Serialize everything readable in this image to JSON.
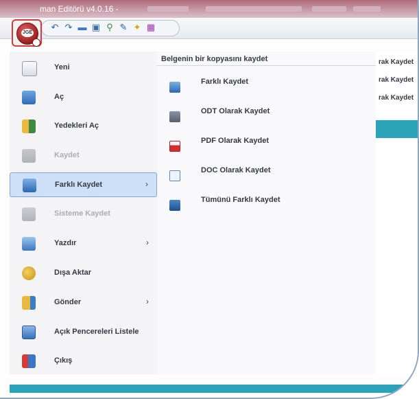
{
  "window": {
    "title": "man Editörü v4.0.16 -"
  },
  "toolbar": {
    "icons": [
      "undo-icon",
      "redo-icon",
      "folder-icon",
      "save-icon",
      "plug-icon",
      "edit-icon",
      "star-icon",
      "grid-icon"
    ],
    "logo_text": "JGE"
  },
  "menu": {
    "items": [
      {
        "label": "Yeni",
        "icon": "new-document-icon",
        "enabled": true,
        "submenu": false
      },
      {
        "label": "Aç",
        "icon": "open-folder-icon",
        "enabled": true,
        "submenu": false
      },
      {
        "label": "Yedekleri Aç",
        "icon": "backup-icon",
        "enabled": true,
        "submenu": false
      },
      {
        "label": "Kaydet",
        "icon": "save-icon",
        "enabled": false,
        "submenu": false
      },
      {
        "label": "Farklı Kaydet",
        "icon": "save-as-icon",
        "enabled": true,
        "submenu": true,
        "active": true
      },
      {
        "label": "Sisteme Kaydet",
        "icon": "system-save-icon",
        "enabled": false,
        "submenu": false
      },
      {
        "label": "Yazdır",
        "icon": "printer-icon",
        "enabled": true,
        "submenu": true
      },
      {
        "label": "Dışa Aktar",
        "icon": "export-icon",
        "enabled": true,
        "submenu": false
      },
      {
        "label": "Gönder",
        "icon": "send-icon",
        "enabled": true,
        "submenu": true
      },
      {
        "label": "Açık Pencereleri Listele",
        "icon": "windows-list-icon",
        "enabled": true,
        "submenu": false
      },
      {
        "label": "Çıkış",
        "icon": "exit-icon",
        "enabled": true,
        "submenu": false
      }
    ],
    "arrow": "›"
  },
  "submenu": {
    "header": "Belgenin bir kopyasını kaydet",
    "items": [
      {
        "label": "Farklı Kaydet",
        "icon": "save-as-icon"
      },
      {
        "label": "ODT Olarak Kaydet",
        "icon": "odt-icon"
      },
      {
        "label": "PDF Olarak Kaydet",
        "icon": "pdf-icon"
      },
      {
        "label": "DOC Olarak Kaydet",
        "icon": "doc-icon"
      },
      {
        "label": "Tümünü Farklı Kaydet",
        "icon": "save-all-icon"
      }
    ]
  },
  "background_panel": {
    "rows": [
      "rak Kaydet",
      "rak Kaydet",
      "rak Kaydet"
    ]
  },
  "colors": {
    "accent": "#2aa2b7",
    "active_item": "#cde0f7",
    "logo": "#b02a2a"
  }
}
